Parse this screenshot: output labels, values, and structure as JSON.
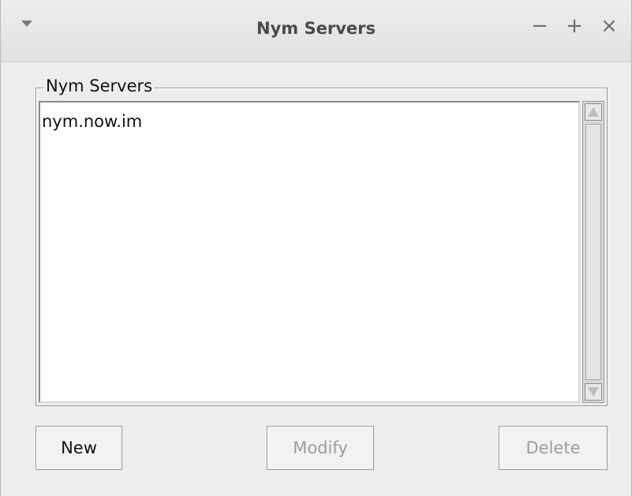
{
  "window": {
    "title": "Nym Servers",
    "controls": {
      "minimize": "−",
      "maximize": "+",
      "close": "×"
    }
  },
  "group": {
    "label": "Nym Servers"
  },
  "list": {
    "items": [
      "nym.now.im"
    ]
  },
  "buttons": {
    "new": "New",
    "modify": "Modify",
    "delete": "Delete"
  }
}
